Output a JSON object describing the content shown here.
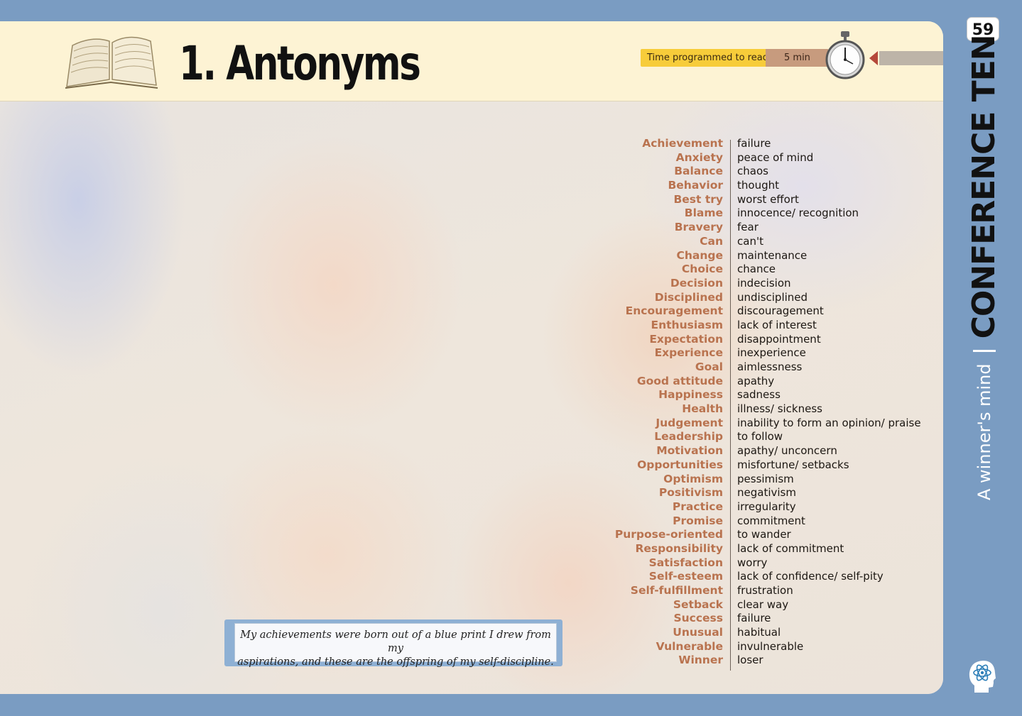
{
  "header": {
    "title": "1. Antonyms",
    "time_label": "Time programmed to read:",
    "time_value": "5 min"
  },
  "page_number": "59",
  "sidebar": {
    "subtitle": "A winner's mind",
    "chapter": "CONFERENCE TEN"
  },
  "quote": {
    "line1": "My achievements were born out of  a blue print I drew from my",
    "line2": "aspirations, and these are the offspring of  my self-discipline."
  },
  "antonyms": [
    {
      "term": "Achievement",
      "antonym": "failure"
    },
    {
      "term": "Anxiety",
      "antonym": "peace of mind"
    },
    {
      "term": "Balance",
      "antonym": "chaos"
    },
    {
      "term": "Behavior",
      "antonym": "thought"
    },
    {
      "term": "Best try",
      "antonym": "worst effort"
    },
    {
      "term": "Blame",
      "antonym": "innocence/ recognition"
    },
    {
      "term": "Bravery",
      "antonym": "fear"
    },
    {
      "term": "Can",
      "antonym": "can't"
    },
    {
      "term": "Change",
      "antonym": "maintenance"
    },
    {
      "term": "Choice",
      "antonym": "chance"
    },
    {
      "term": "Decision",
      "antonym": "indecision"
    },
    {
      "term": "Disciplined",
      "antonym": "undisciplined"
    },
    {
      "term": "Encouragement",
      "antonym": "discouragement"
    },
    {
      "term": "Enthusiasm",
      "antonym": "lack of interest"
    },
    {
      "term": "Expectation",
      "antonym": "disappointment"
    },
    {
      "term": "Experience",
      "antonym": "inexperience"
    },
    {
      "term": "Goal",
      "antonym": "aimlessness"
    },
    {
      "term": "Good attitude",
      "antonym": "apathy"
    },
    {
      "term": "Happiness",
      "antonym": "sadness"
    },
    {
      "term": "Health",
      "antonym": "illness/ sickness"
    },
    {
      "term": "Judgement",
      "antonym": "inability to form an opinion/ praise"
    },
    {
      "term": "Leadership",
      "antonym": "to follow"
    },
    {
      "term": "Motivation",
      "antonym": "apathy/ unconcern"
    },
    {
      "term": "Opportunities",
      "antonym": "misfortune/ setbacks"
    },
    {
      "term": "Optimism",
      "antonym": "pessimism"
    },
    {
      "term": "Positivism",
      "antonym": "negativism"
    },
    {
      "term": "Practice",
      "antonym": "irregularity"
    },
    {
      "term": "Promise",
      "antonym": "commitment"
    },
    {
      "term": "Purpose-oriented",
      "antonym": "to wander"
    },
    {
      "term": "Responsibility",
      "antonym": "lack of commitment"
    },
    {
      "term": "Satisfaction",
      "antonym": "worry"
    },
    {
      "term": "Self-esteem",
      "antonym": "lack of confidence/ self-pity"
    },
    {
      "term": "Self-fulfillment",
      "antonym": "frustration"
    },
    {
      "term": "Setback",
      "antonym": "clear way"
    },
    {
      "term": "Success",
      "antonym": "failure"
    },
    {
      "term": "Unusual",
      "antonym": "habitual"
    },
    {
      "term": "Vulnerable",
      "antonym": "invulnerable"
    },
    {
      "term": "Winner",
      "antonym": "loser"
    }
  ],
  "colors": {
    "frame": "#7a9cc2",
    "header_bg": "#fdf3d4",
    "term": "#b9734f",
    "time_label_bg": "#f7cc3a",
    "time_value_bg": "#c79b7e"
  }
}
